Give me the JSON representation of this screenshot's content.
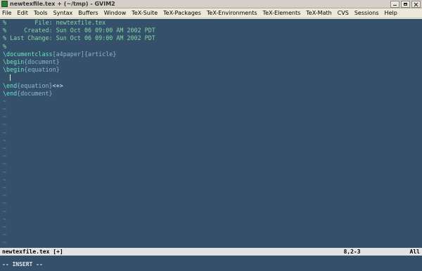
{
  "window": {
    "title": "newtexfile.tex + (~/tmp) - GVIM2"
  },
  "menu": [
    "File",
    "Edit",
    "Tools",
    "Syntax",
    "Buffers",
    "Window",
    "TeX-Suite",
    "TeX-Packages",
    "TeX-Environments",
    "TeX-Elements",
    "TeX-Math",
    "CVS",
    "Sessions",
    "Help"
  ],
  "editor": {
    "header_comment": {
      "line1": "%        File: newtexfile.tex",
      "line2": "%     Created: Sun Oct 06 09:00 AM 2002 PDT",
      "line3": "% Last Change: Sun Oct 06 09:00 AM 2002 PDT",
      "line4": "%"
    },
    "documentclass": {
      "cmd": "\\documentclass",
      "opt": "[a4paper]",
      "arg": "{article}"
    },
    "begin_document": {
      "cmd": "\\begin",
      "arg": "{document}"
    },
    "begin_equation": {
      "cmd": "\\begin",
      "arg": "{equation}"
    },
    "end_equation": {
      "cmd": "\\end",
      "arg": "{equation}",
      "marker": "<+>"
    },
    "end_document": {
      "cmd": "\\end",
      "arg": "{document}"
    },
    "tilde": "~",
    "filler_line_count": 19
  },
  "statusline": {
    "filename": "newtexfile.tex [+]",
    "position": "8,2-3",
    "scroll": "All"
  },
  "cmdline": {
    "mode": "-- INSERT --"
  }
}
